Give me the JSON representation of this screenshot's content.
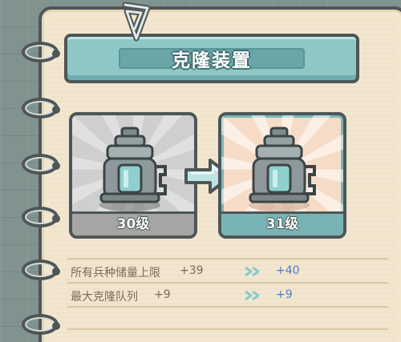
{
  "panel": {
    "title": "克隆装置"
  },
  "upgrade": {
    "current_level": "30级",
    "next_level": "31级"
  },
  "stats": [
    {
      "label": "所有兵种储量上限",
      "current": "+39",
      "next": "+40"
    },
    {
      "label": "最大克隆队列",
      "current": "+9",
      "next": "+9"
    }
  ],
  "icons": {
    "clip": "paperclip-icon",
    "device": "clone-device-icon",
    "arrow": "upgrade-arrow-icon",
    "double_chevron": "double-chevron-icon"
  },
  "colors": {
    "banner": "#8fc7c7",
    "paper": "#f3e6cf",
    "outline": "#4e5657",
    "next_value": "#4a7bd0"
  }
}
